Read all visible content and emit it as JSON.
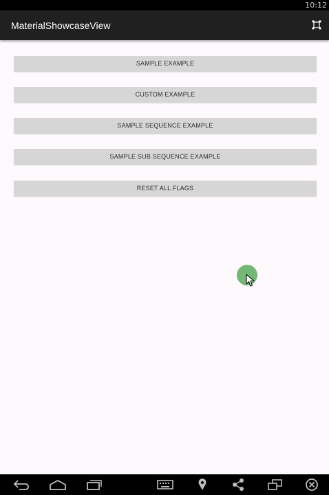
{
  "status_bar": {
    "time": "10:12"
  },
  "app_bar": {
    "title": "MaterialShowcaseView",
    "action_icon": "fullscreen-toggle-icon"
  },
  "buttons": [
    {
      "label": "SAMPLE EXAMPLE"
    },
    {
      "label": "CUSTOM EXAMPLE"
    },
    {
      "label": "SAMPLE SEQUENCE EXAMPLE"
    },
    {
      "label": "SAMPLE SUB SEQUENCE EXAMPLE"
    },
    {
      "label": "RESET ALL FLAGS"
    }
  ],
  "navigation_bar": {
    "icons": [
      "back-icon",
      "home-icon",
      "recent-apps-icon",
      "keyboard-icon",
      "location-icon",
      "share-icon",
      "rotate-icon",
      "close-icon"
    ]
  },
  "colors": {
    "app_bar": "#202020",
    "background": "#fdf9fd",
    "button": "#d6d6d6",
    "touch_indicator": "#6bb46f"
  }
}
